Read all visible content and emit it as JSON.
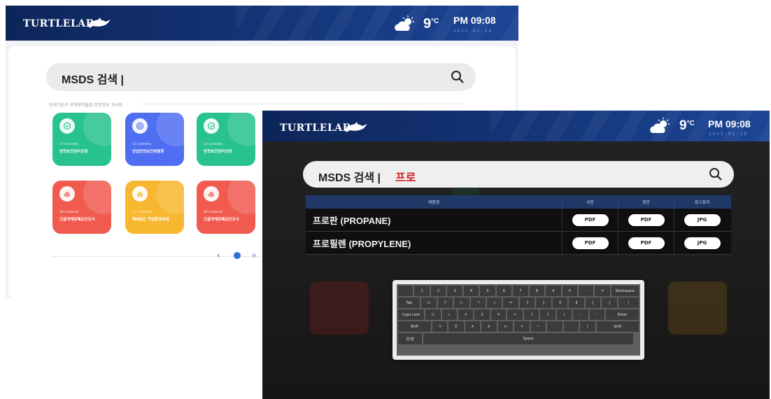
{
  "header": {
    "logo_text": "TURTLELAB",
    "temperature": "9",
    "temp_unit": "°C",
    "time": "PM 09:08",
    "date": "2022.02.28"
  },
  "back_screen": {
    "search_label": "MSDS 검색 |",
    "caption": "현재기준의 위해화학물질 안전정보 게시판",
    "cards": [
      {
        "count": "37 Contents",
        "title": "안전보건관리규정",
        "color": "#27c28d"
      },
      {
        "count": "12 Contents",
        "title": "산업안전보건위원회",
        "color": "#4f6ef2"
      },
      {
        "count": "14 Contents",
        "title": "안전보건관리규정",
        "color": "#27c28d"
      },
      {
        "count": "18 Contents",
        "title": "근골격계유해요인조사",
        "color": "#f05a4f"
      },
      {
        "count": "11 Contents",
        "title": "폐쇄공간 작업환경측정",
        "color": "#f7b730"
      },
      {
        "count": "06 Contents",
        "title": "근골격계유해요인조사",
        "color": "#f05a4f"
      }
    ],
    "pager_prev": "‹"
  },
  "front_screen": {
    "search_label": "MSDS 검색 |",
    "search_query": "프로",
    "table": {
      "headers": [
        "제품명",
        "국문",
        "영문",
        "경고표지"
      ],
      "rows": [
        {
          "name": "프로판 (PROPANE)",
          "kr": "PDF",
          "en": "PDF",
          "label": "JPG"
        },
        {
          "name": "프로필렌 (PROPYLENE)",
          "kr": "PDF",
          "en": "PDF",
          "label": "JPG"
        }
      ]
    },
    "keyboard": {
      "rows": [
        [
          "`",
          "1",
          "2",
          "3",
          "4",
          "5",
          "6",
          "7",
          "8",
          "9",
          "0",
          "-",
          "=",
          "Backspace"
        ],
        [
          "Tab",
          "ㅂ",
          "ㅈ",
          "ㄷ",
          "ㄱ",
          "ㅅ",
          "ㅛ",
          "ㅕ",
          "ㅑ",
          "ㅐ",
          "ㅔ",
          "[",
          "]",
          "\\"
        ],
        [
          "Caps Lock",
          "ㅁ",
          "ㄴ",
          "ㅇ",
          "ㄹ",
          "ㅎ",
          "ㅗ",
          "ㅓ",
          "ㅏ",
          "ㅣ",
          ";",
          "'",
          "Enter"
        ],
        [
          "Shift",
          "ㅋ",
          "ㅌ",
          "ㅊ",
          "ㅍ",
          "ㅠ",
          "ㅜ",
          "ㅡ",
          ",",
          ".",
          "/",
          "Shift"
        ]
      ],
      "lang_key": "한/영",
      "space_key": "Space"
    }
  }
}
